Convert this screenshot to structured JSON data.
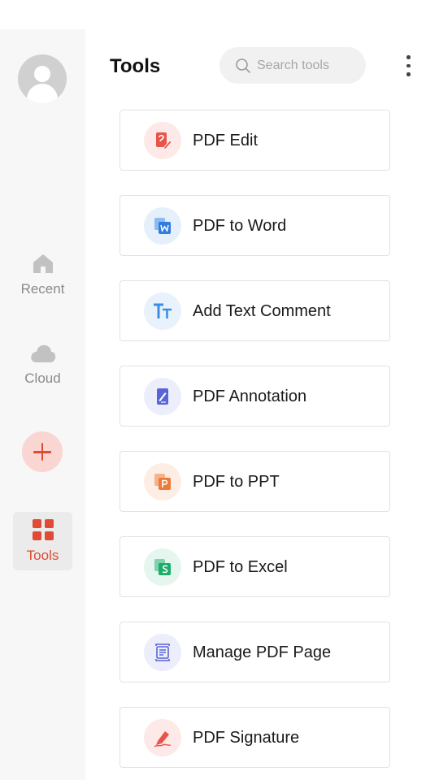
{
  "sidebar": {
    "nav": [
      {
        "id": "recent",
        "label": "Recent",
        "icon": "home-icon",
        "active": false
      },
      {
        "id": "cloud",
        "label": "Cloud",
        "icon": "cloud-icon",
        "active": false
      },
      {
        "id": "tools",
        "label": "Tools",
        "icon": "grid-icon",
        "active": true
      }
    ],
    "add_icon": "plus-icon"
  },
  "header": {
    "title": "Tools",
    "search_placeholder": "Search tools",
    "search_icon": "search-icon",
    "more_icon": "more-vertical-icon"
  },
  "tools": [
    {
      "label": "PDF Edit",
      "icon": "pdf-edit-icon",
      "color": "#e8534a",
      "bg": "#fde9e7"
    },
    {
      "label": "PDF to Word",
      "icon": "word-icon",
      "color": "#2f7de0",
      "bg": "#e6f0fb"
    },
    {
      "label": "Add Text Comment",
      "icon": "text-icon",
      "color": "#3a8ee6",
      "bg": "#e8f2fc"
    },
    {
      "label": "PDF Annotation",
      "icon": "annotation-icon",
      "color": "#5865d8",
      "bg": "#eceefb"
    },
    {
      "label": "PDF to PPT",
      "icon": "ppt-icon",
      "color": "#ee7a3a",
      "bg": "#fdeee5"
    },
    {
      "label": "PDF to Excel",
      "icon": "excel-icon",
      "color": "#1cac6b",
      "bg": "#e5f6ee"
    },
    {
      "label": "Manage PDF Page",
      "icon": "manage-pages-icon",
      "color": "#5865d8",
      "bg": "#eceefb"
    },
    {
      "label": "PDF Signature",
      "icon": "signature-icon",
      "color": "#e8534a",
      "bg": "#fde9e7"
    }
  ],
  "colors": {
    "accent": "#e14a34",
    "sidebar_bg": "#f7f7f7",
    "inactive_nav": "#8a8a8a"
  }
}
